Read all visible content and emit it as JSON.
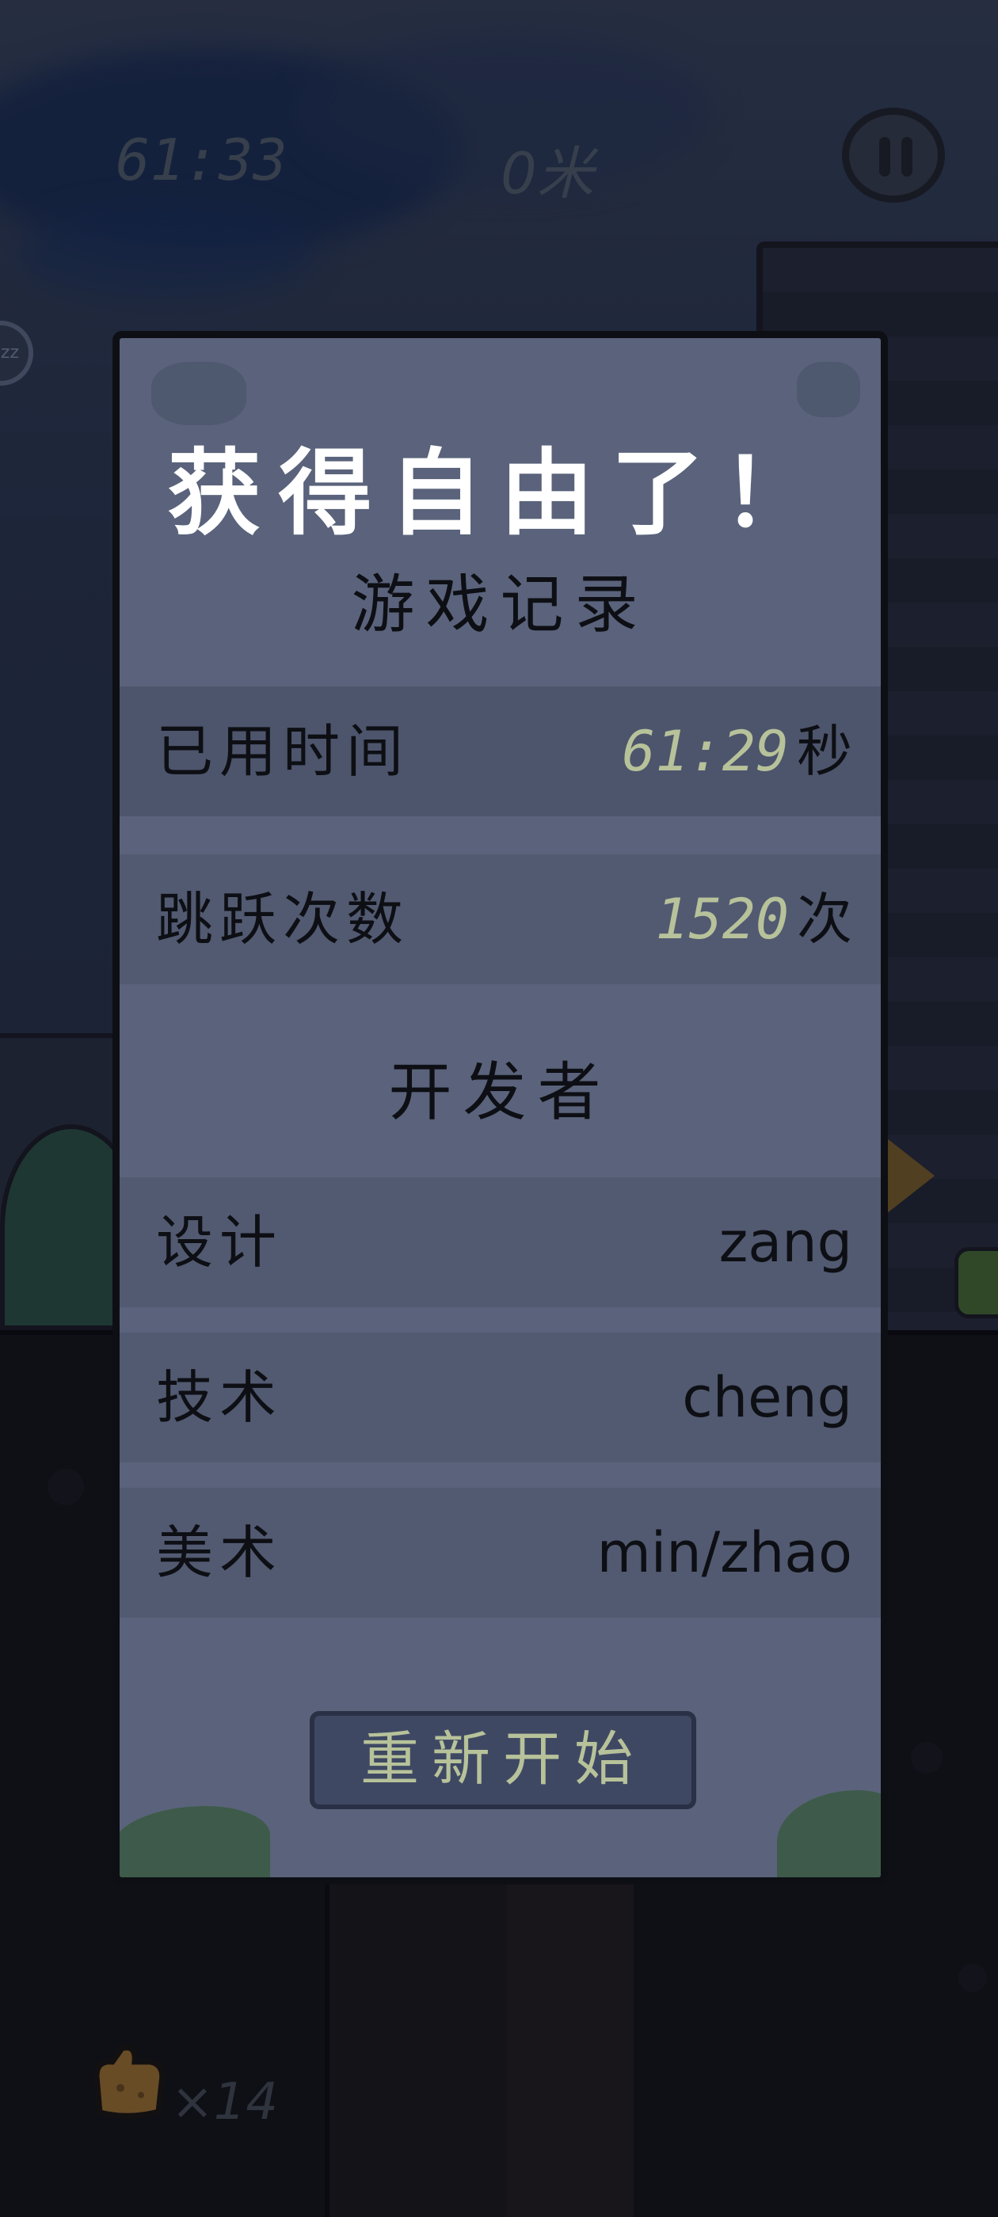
{
  "hud": {
    "time": "61:33",
    "distance": "0米",
    "pause_icon": "pause-icon",
    "bread_count": "×14",
    "bread_icon": "bread-icon"
  },
  "modal": {
    "title": "获得自由了！",
    "record_heading": "游戏记录",
    "records": [
      {
        "label": "已用时间",
        "value": "61:29",
        "unit": "秒"
      },
      {
        "label": "跳跃次数",
        "value": "1520",
        "unit": "次"
      }
    ],
    "developer_heading": "开发者",
    "developers": [
      {
        "label": "设计",
        "value": "zang"
      },
      {
        "label": "技术",
        "value": "cheng"
      },
      {
        "label": "美术",
        "value": "min/zhao"
      }
    ],
    "restart_label": "重新开始"
  },
  "colors": {
    "panel": "#5a637b",
    "row": "#525a71",
    "accent_value": "#b7c29a",
    "button": "#3f4863"
  }
}
